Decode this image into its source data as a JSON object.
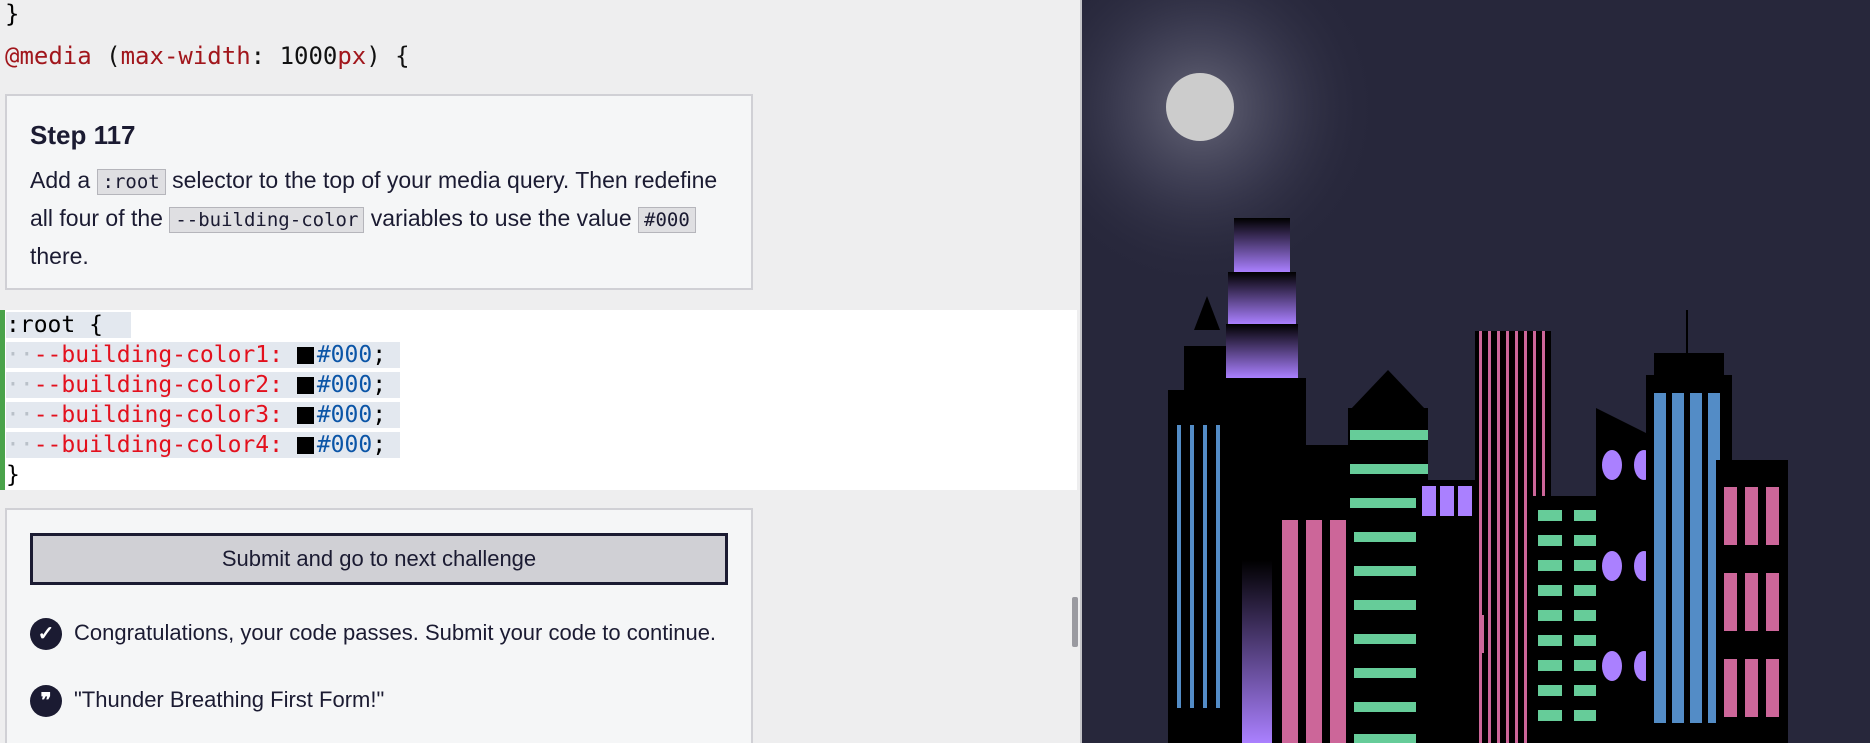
{
  "code_above": {
    "closing_brace": "}",
    "media_at": "@media",
    "media_open": " (",
    "media_prop": "max-width",
    "media_colon": ": ",
    "media_value": "1000",
    "media_unit": "px",
    "media_close": ") {"
  },
  "step": {
    "title": "Step 117",
    "text_1": "Add a ",
    "chip_1": ":root",
    "text_2": " selector to the top of your media query. Then redefine all four of the ",
    "chip_2": "--building-color",
    "text_3": " variables to use the value ",
    "chip_3": "#000",
    "text_4": " there."
  },
  "editor": {
    "selector": ":root {",
    "lines": [
      {
        "prop": "--building-color1: ",
        "value": "#000",
        "end": ";"
      },
      {
        "prop": "--building-color2: ",
        "value": "#000",
        "end": ";"
      },
      {
        "prop": "--building-color3: ",
        "value": "#000",
        "end": ";"
      },
      {
        "prop": "--building-color4: ",
        "value": "#000",
        "end": ";"
      }
    ],
    "closing": "}",
    "swatch_color": "#000000"
  },
  "actions": {
    "submit_label": "Submit and go to next challenge",
    "success_message": "Congratulations, your code passes. Submit your code to continue.",
    "quote": "\"Thunder Breathing First Form!\"",
    "check_icon": "check-circle-icon",
    "quote_icon": "quote-icon"
  },
  "preview": {
    "sky_color": "#27273b",
    "moon_color": "#cccccc",
    "accent_colors": [
      "#aa80ff",
      "#66cc99",
      "#cc6699",
      "#538cc6"
    ]
  }
}
